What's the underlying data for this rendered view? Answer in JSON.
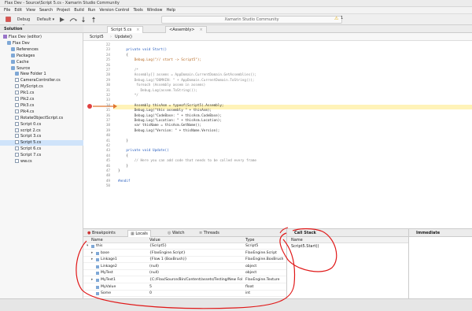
{
  "window": {
    "title": "Flax Dev - Source\\Script 5.cs - Xamarin Studio Community"
  },
  "menu": [
    "File",
    "Edit",
    "View",
    "Search",
    "Project",
    "Build",
    "Run",
    "Version Control",
    "Tools",
    "Window",
    "Help"
  ],
  "toolbar": {
    "config": "Debug",
    "config_arrow": "▾",
    "target": "Default",
    "target_arrow": "▾",
    "status": "Xamarin Studio Community",
    "warning_count": "1"
  },
  "solution": {
    "header": "Solution",
    "items": [
      {
        "label": "Flax Dev (editor)",
        "indent": 0,
        "kind": "sol"
      },
      {
        "label": "Flax Dev",
        "indent": 1,
        "kind": "folder"
      },
      {
        "label": "References",
        "indent": 2,
        "kind": "folder"
      },
      {
        "label": "Packages",
        "indent": 2,
        "kind": "folder"
      },
      {
        "label": "Cache",
        "indent": 2,
        "kind": "folder"
      },
      {
        "label": "Source",
        "indent": 2,
        "kind": "folder"
      },
      {
        "label": "New Folder 1",
        "indent": 3,
        "kind": "folder"
      },
      {
        "label": "CameraController.cs",
        "indent": 3,
        "kind": "file"
      },
      {
        "label": "MyScript.cs",
        "indent": 3,
        "kind": "file"
      },
      {
        "label": "Pik1.cs",
        "indent": 3,
        "kind": "file"
      },
      {
        "label": "Pik2.cs",
        "indent": 3,
        "kind": "file"
      },
      {
        "label": "Pik3.cs",
        "indent": 3,
        "kind": "file"
      },
      {
        "label": "Pik4.cs",
        "indent": 3,
        "kind": "file"
      },
      {
        "label": "RotateObjectScript.cs",
        "indent": 3,
        "kind": "file"
      },
      {
        "label": "Script 0.cs",
        "indent": 3,
        "kind": "file"
      },
      {
        "label": "script 2.cs",
        "indent": 3,
        "kind": "file"
      },
      {
        "label": "Script 3.cs",
        "indent": 3,
        "kind": "file"
      },
      {
        "label": "Script 5.cs",
        "indent": 3,
        "kind": "file",
        "selected": true
      },
      {
        "label": "Script 6.cs",
        "indent": 3,
        "kind": "file"
      },
      {
        "label": "Script 7.cs",
        "indent": 3,
        "kind": "file"
      },
      {
        "label": "ww.cs",
        "indent": 3,
        "kind": "file"
      }
    ]
  },
  "tabs": [
    {
      "label": "Script 5.cs",
      "active": true
    },
    {
      "label": "<Assembly>",
      "active": false
    }
  ],
  "breadcrumb": {
    "cls": "Script5",
    "method": "Update()"
  },
  "code": {
    "lines": [
      {
        "n": "22",
        "t": ""
      },
      {
        "n": "23",
        "t": "    private void Start()",
        "c": "kw"
      },
      {
        "n": "24",
        "t": "    {"
      },
      {
        "n": "25",
        "t": "        Debug.Log(\"// start -> Script5\");",
        "c": "st"
      },
      {
        "n": "26",
        "t": ""
      },
      {
        "n": "27",
        "t": "        /*",
        "c": "cm"
      },
      {
        "n": "28",
        "t": "        Assembly[] assems = AppDomain.CurrentDomain.GetAssemblies();",
        "c": "cm"
      },
      {
        "n": "29",
        "t": "        Debug.Log(\"DOMAIN: \" + AppDomain.CurrentDomain.ToString());",
        "c": "cm"
      },
      {
        "n": "30",
        "t": "         foreach (Assembly assem in assems)",
        "c": "cm"
      },
      {
        "n": "31",
        "t": "           Debug.Log(assem.ToString());",
        "c": "cm"
      },
      {
        "n": "32",
        "t": "        */",
        "c": "cm"
      },
      {
        "n": "33",
        "t": ""
      },
      {
        "n": "34",
        "t": "        Assembly thisAsm = typeof(Script5).Assembly;"
      },
      {
        "n": "35",
        "t": "        Debug.Log(\"this assembly \" + thisAsm);"
      },
      {
        "n": "36",
        "t": "        Debug.Log(\"CodeBase: \" + thisAsm.CodeBase);"
      },
      {
        "n": "37",
        "t": "        Debug.Log(\"Location: \" + thisAsm.Location);"
      },
      {
        "n": "38",
        "t": "        var thisName = thisAsm.GetName();"
      },
      {
        "n": "39",
        "t": "        Debug.Log(\"Version: \" + thisName.Version);"
      },
      {
        "n": "40",
        "t": ""
      },
      {
        "n": "41",
        "t": "    }"
      },
      {
        "n": "42",
        "t": ""
      },
      {
        "n": "43",
        "t": "    private void Update()",
        "c": "kw"
      },
      {
        "n": "44",
        "t": "    {"
      },
      {
        "n": "45",
        "t": "        // Here you can add code that needs to be called every frame",
        "c": "cm"
      },
      {
        "n": "46",
        "t": "    }"
      },
      {
        "n": "47",
        "t": "}"
      },
      {
        "n": "48",
        "t": ""
      },
      {
        "n": "49",
        "t": "#endif",
        "c": "kw"
      },
      {
        "n": "50",
        "t": ""
      }
    ]
  },
  "debug_tabs": [
    "Breakpoints",
    "Locals",
    "Watch",
    "Threads"
  ],
  "locals": {
    "headers": {
      "name": "Name",
      "value": "Value",
      "type": "Type"
    },
    "rows": [
      {
        "name": "this",
        "value": "{Script5}",
        "type": "Script5",
        "expander": "▾",
        "indent": 0
      },
      {
        "name": "base",
        "value": "{FlaxEngine.Script}",
        "type": "FlaxEngine.Script",
        "expander": "▸",
        "indent": 1
      },
      {
        "name": "Linkage1",
        "value": "{Flow 1 (BoxBrush)}",
        "type": "FlaxEngine.BoxBrush",
        "expander": "▸",
        "indent": 1
      },
      {
        "name": "Linkage2",
        "value": "(null)",
        "type": "object",
        "expander": "",
        "indent": 1
      },
      {
        "name": "MyTest",
        "value": "(null)",
        "type": "object",
        "expander": "",
        "indent": 1
      },
      {
        "name": "MyText1",
        "value": "{C:/Flax/Source/Bin/Content/assets/Testing/New Folder (2)...",
        "type": "FlaxEngine.Texture",
        "expander": "▸",
        "indent": 1
      },
      {
        "name": "MyValue",
        "value": "5",
        "type": "float",
        "expander": "",
        "indent": 1
      },
      {
        "name": "Some",
        "value": "0",
        "type": "int",
        "expander": "",
        "indent": 1
      }
    ]
  },
  "call_stack": {
    "title": "Call Stack",
    "column": "Name",
    "rows": [
      "Script5.Start()"
    ]
  },
  "immediate": {
    "title": "Immediate"
  }
}
